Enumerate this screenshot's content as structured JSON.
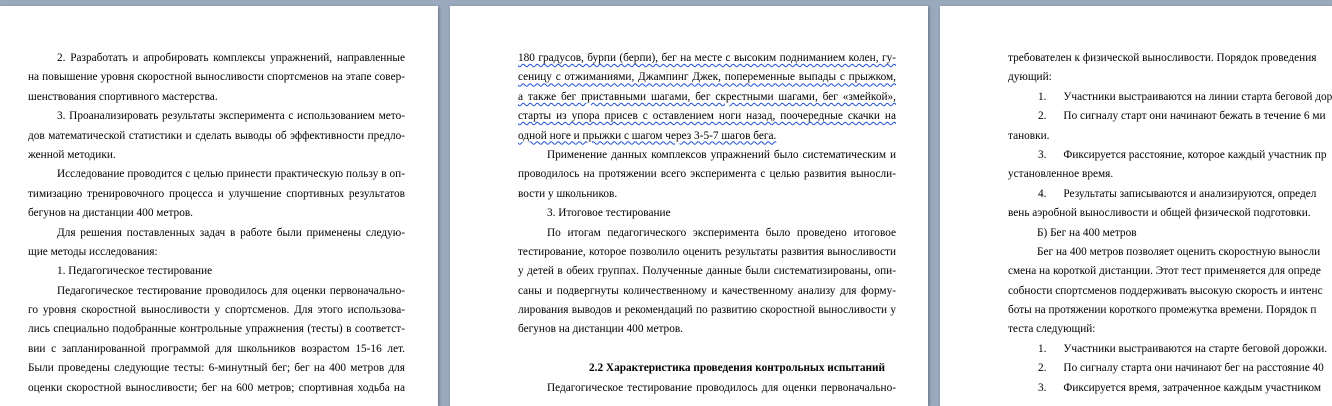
{
  "pages": [
    {
      "lines": [
        {
          "t": "2. Разработать и апробировать комплексы упражнений, направленные",
          "c": "j ind"
        },
        {
          "t": "на повышение уровня скоростной выносливости спортсменов на этапе совер-",
          "c": "j"
        },
        {
          "t": "шенствования спортивного мастерства.",
          "c": ""
        },
        {
          "t": "3. Проанализировать результаты эксперимента с использованием мето-",
          "c": "j ind"
        },
        {
          "t": "дов математической статистики и сделать выводы об эффективности предло-",
          "c": "j"
        },
        {
          "t": "женной методики.",
          "c": ""
        },
        {
          "t": "Исследование проводится с целью принести практическую пользу в оп-",
          "c": "j ind"
        },
        {
          "t": "тимизацию тренировочного процесса и улучшение спортивных результатов",
          "c": "j"
        },
        {
          "t": "бегунов на дистанции 400 метров.",
          "c": ""
        },
        {
          "t": "Для решения поставленных задач в работе были применены следую-",
          "c": "j ind"
        },
        {
          "t": "щие методы исследования:",
          "c": ""
        },
        {
          "t": "1. Педагогическое тестирование",
          "c": "ind"
        },
        {
          "t": "Педагогическое тестирование проводилось для оценки первоначально-",
          "c": "j ind"
        },
        {
          "t": "го уровня скоростной выносливости у спортсменов. Для этого использова-",
          "c": "j"
        },
        {
          "t": "лись специально подобранные контрольные упражнения (тесты) в соответст-",
          "c": "j"
        },
        {
          "t": "вии с запланированной программой для школьников возрастом 15-16 лет.",
          "c": "j"
        },
        {
          "t": "Были проведены следующие тесты: 6-минутный бег; бег на 400 метров для",
          "c": "j"
        },
        {
          "t": "оценки скоростной выносливости; бег на 600 метров; спортивная ходьба на",
          "c": "j"
        }
      ]
    },
    {
      "lines": [
        {
          "t": "180 градусов, бурпи (берпи), бег на месте с высоким подниманием колен, гу-",
          "c": "j sqline"
        },
        {
          "t": "сеницу с отжиманиями, Джампинг Джек, попеременные выпады с прыжком,",
          "c": "j sqline"
        },
        {
          "t": "а также бег приставными шагами, бег скрестными шагами, бег «змейкой»,",
          "c": "j sqline"
        },
        {
          "t": "старты из упора присев с оставлением ноги назад, поочередные скачки на",
          "c": "j sqline"
        },
        {
          "t": "одной ноге и прыжки с шагом через 3-5-7 шагов бега.",
          "c": "sqpart"
        },
        {
          "t": "Применение данных комплексов упражнений было систематическим и",
          "c": "j ind"
        },
        {
          "t": "проводилось на протяжении всего эксперимента с целью развития выносли-",
          "c": "j"
        },
        {
          "t": "вости у школьников.",
          "c": ""
        },
        {
          "t": "3. Итоговое тестирование",
          "c": "ind"
        },
        {
          "t": "По итогам педагогического эксперимента было проведено итоговое",
          "c": "j ind"
        },
        {
          "t": "тестирование, которое позволило оценить результаты развития выносливости",
          "c": "j"
        },
        {
          "t": "у детей в обеих группах. Полученные данные были систематизированы, опи-",
          "c": "j"
        },
        {
          "t": "саны и подвергнуты количественному и качественному анализу для форму-",
          "c": "j"
        },
        {
          "t": "лирования выводов и рекомендаций по развитию скоростной выносливости у",
          "c": "j"
        },
        {
          "t": "бегунов на дистанции 400 метров.",
          "c": ""
        },
        {
          "t": "",
          "c": "blank"
        },
        {
          "t": "2.2 Характеристика проведения контрольных испытаний",
          "c": "head"
        },
        {
          "t": "Педагогическое тестирование проводилось для оценки первоначально-",
          "c": "j ind"
        }
      ]
    },
    {
      "lines": [
        {
          "t": "требователен к физической выносливости. Порядок проведения",
          "c": ""
        },
        {
          "t": "дующий:",
          "c": ""
        },
        {
          "t": "1.      Участники выстраиваются на линии старта беговой дор",
          "c": "list"
        },
        {
          "t": "2.      По сигналу старт они начинают бежать в течение 6 ми",
          "c": "list"
        },
        {
          "t": "тановки.",
          "c": ""
        },
        {
          "t": "3.      Фиксируется расстояние, которое каждый участник пр",
          "c": "list"
        },
        {
          "t": "установленное время.",
          "c": ""
        },
        {
          "t": "4.      Результаты записываются и анализируются, определ",
          "c": "list"
        },
        {
          "t": "вень аэробной выносливости и общей физической подготовки.",
          "c": ""
        },
        {
          "t": "Б) Бег на 400 метров",
          "c": "ind"
        },
        {
          "t": "Бег на 400 метров позволяет оценить скоростную выносли",
          "c": "ind"
        },
        {
          "t": "смена на короткой дистанции. Этот тест применяется для опреде",
          "c": ""
        },
        {
          "t": "собности спортсменов поддерживать высокую скорость и интенс",
          "c": ""
        },
        {
          "t": "боты на протяжении короткого промежутка времени. Порядок п",
          "c": ""
        },
        {
          "t": "теста следующий:",
          "c": ""
        },
        {
          "t": "1.      Участники выстраиваются на старте беговой дорожки.",
          "c": "list"
        },
        {
          "t": "2.      По сигналу старта они начинают бег на расстояние 40",
          "c": "list"
        },
        {
          "t": "3.      Фиксируется время, затраченное каждым участником",
          "c": "list"
        }
      ]
    }
  ]
}
